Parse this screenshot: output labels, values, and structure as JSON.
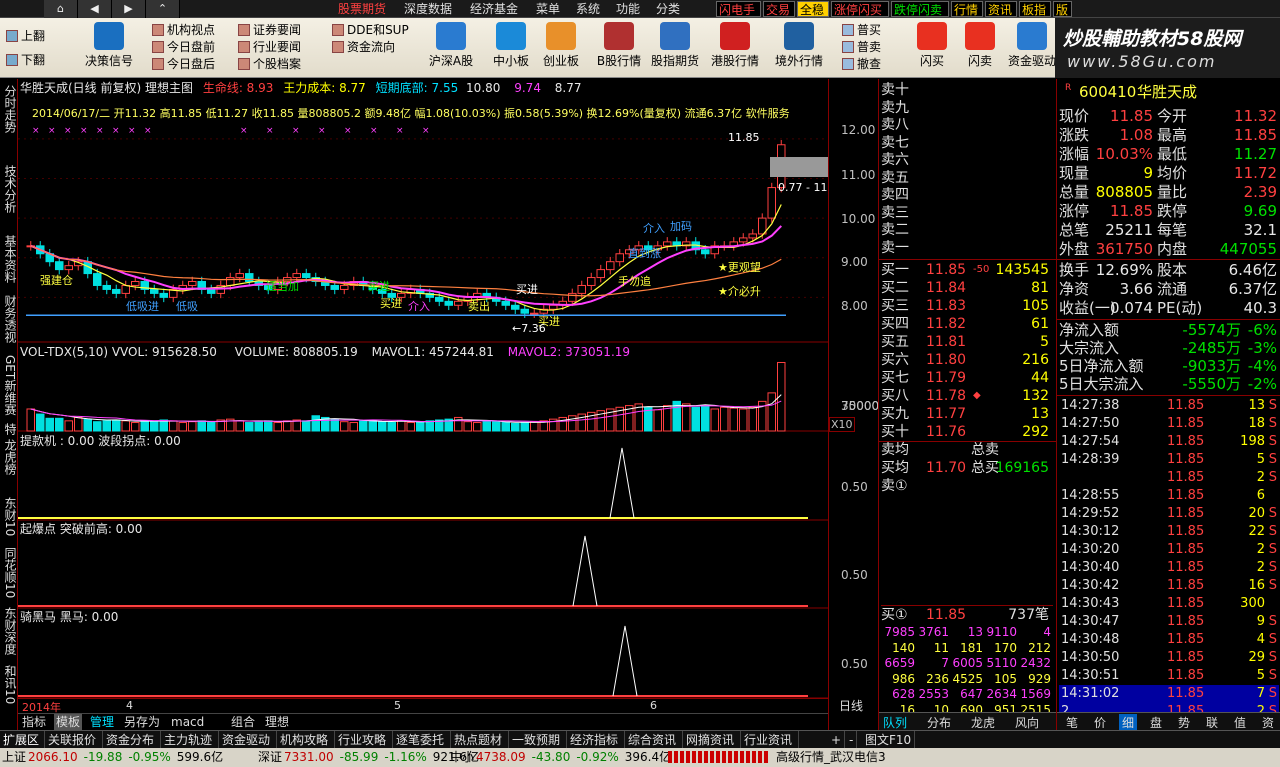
{
  "nav_buttons": [
    "⌂",
    "◀",
    "▶",
    "⌃"
  ],
  "menu": [
    "股票期货",
    "深度数据",
    "经济基金",
    "菜单",
    "系统",
    "功能",
    "分类"
  ],
  "top_tags": [
    {
      "label": "闪电手",
      "color": "#ff4040",
      "bg": "#000"
    },
    {
      "label": "交易",
      "color": "#ff4040",
      "bg": "#000"
    },
    {
      "label": "全稳",
      "color": "#000",
      "bg": "#ffd000"
    },
    {
      "label": "涨停闪买",
      "color": "#ff4040",
      "bg": "#000"
    },
    {
      "label": "跌停闪卖",
      "color": "#00e000",
      "bg": "#000"
    },
    {
      "label": "行情",
      "color": "#ffd000",
      "bg": "#000"
    },
    {
      "label": "资讯",
      "color": "#ffd000",
      "bg": "#000"
    },
    {
      "label": "板指",
      "color": "#ffd000",
      "bg": "#000"
    },
    {
      "label": "版",
      "color": "#ffd000",
      "bg": "#000"
    }
  ],
  "brand": {
    "title": "炒股輔助教材58股网",
    "url": "www.58Gu.com"
  },
  "toolbar": {
    "updown": [
      "上翻",
      "下翻"
    ],
    "decision": "决策信号",
    "small": [
      [
        "机构视点",
        "今日盘前",
        "今日盘后"
      ],
      [
        "证券要闻",
        "行业要闻",
        "个股档案"
      ],
      [
        "DDE和SUP",
        "资金流向"
      ]
    ],
    "big": [
      "沪深A股",
      "中小板",
      "创业板",
      "B股行情",
      "股指期货",
      "港股行情",
      "境外行情"
    ],
    "small2": [
      "普买",
      "普卖",
      "撤查"
    ],
    "big2": [
      "闪买",
      "闪卖",
      "资金驱动",
      "资金博弈",
      "DDE排名"
    ]
  },
  "left_tabs": [
    "分时走势",
    "技术分析",
    "基本资料",
    "财务透视",
    "GET新维赛",
    "特",
    "龙虎榜",
    "东财10",
    "同花顺10",
    "东财深度",
    "和讯10"
  ],
  "chart": {
    "header1": [
      "华胜天成(日线 前复权) 理想主图",
      "生命线: 8.93",
      "王力成本: 8.77",
      "短期底部: 7.55",
      "10.80",
      "9.74",
      "8.77"
    ],
    "header2": "2014/06/17/二  开11.32  高11.85  低11.27  收11.85  量808805.2  额9.48亿  幅1.08(10.03%)  振0.58(5.39%)  换12.69%(量复权)  流通6.37亿  软件服务",
    "annot": {
      "high": "11.85",
      "low": "7.36",
      "range": "0.77 - 11"
    },
    "labels": [
      "强建仓",
      "低吸进",
      "低吸",
      "适当加",
      "买进",
      "买进",
      "介入",
      "卖出",
      "买进",
      "买进",
      "手勿追",
      "直到涨",
      "介入",
      "加码",
      "★更观望",
      "★介必升"
    ],
    "vol_header": [
      "VOL-TDX(5,10)  VVOL: 915628.50",
      "VOLUME: 808805.19",
      "MAVOL1: 457244.81",
      "MAVOL2: 373051.19"
    ],
    "ind1": "提款机 : 0.00  波段拐点: 0.00",
    "ind2": "起爆点  突破前高: 0.00",
    "ind3": "骑黑马  黑马: 0.00",
    "year_axis": [
      "2014年",
      "4",
      "5",
      "6"
    ],
    "price_axis": [
      "12.00",
      "11.00",
      "10.00",
      "9.00",
      "8.00"
    ],
    "vol_axis": [
      "70000",
      "35000",
      "X10"
    ],
    "ind_axis": [
      "0.50",
      "0.50",
      "0.50"
    ],
    "period": "日线",
    "tabs": [
      "指标",
      "模板",
      "管理",
      "另存为",
      "macd",
      "组合",
      "理想"
    ]
  },
  "chart_data": {
    "type": "candlestick",
    "ylim": [
      7,
      12.5
    ],
    "close": [
      9.3,
      9.1,
      8.9,
      8.7,
      8.8,
      8.9,
      8.6,
      8.3,
      8.2,
      8.1,
      8.3,
      8.4,
      8.2,
      8.1,
      8.0,
      8.2,
      8.3,
      8.4,
      8.2,
      8.1,
      8.3,
      8.5,
      8.6,
      8.4,
      8.3,
      8.2,
      8.4,
      8.5,
      8.6,
      8.5,
      8.4,
      8.3,
      8.2,
      8.3,
      8.4,
      8.3,
      8.2,
      8.1,
      8.0,
      8.1,
      8.2,
      8.1,
      8.0,
      7.9,
      7.8,
      7.9,
      8.0,
      8.1,
      8.0,
      7.9,
      7.8,
      7.7,
      7.6,
      7.6,
      7.7,
      7.8,
      7.9,
      8.1,
      8.3,
      8.5,
      8.7,
      8.9,
      9.1,
      9.2,
      9.3,
      9.2,
      9.3,
      9.4,
      9.3,
      9.4,
      9.2,
      9.1,
      9.3,
      9.3,
      9.4,
      9.5,
      9.6,
      10.0,
      10.77,
      11.85
    ],
    "volume": [
      26000,
      20000,
      15000,
      15000,
      12000,
      16000,
      14000,
      11000,
      12000,
      13000,
      12000,
      10000,
      12000,
      11000,
      13000,
      12000,
      10000,
      11000,
      12000,
      10000,
      13000,
      14000,
      12000,
      10000,
      11000,
      12000,
      10000,
      12000,
      13000,
      12000,
      18000,
      16000,
      14000,
      11000,
      10000,
      12000,
      13000,
      11000,
      10000,
      12000,
      10000,
      11000,
      12000,
      13000,
      14000,
      16000,
      11000,
      10000,
      12000,
      11000,
      10000,
      9000,
      10000,
      11000,
      12000,
      14000,
      16000,
      18000,
      20000,
      22000,
      24000,
      26000,
      28000,
      30000,
      32000,
      28000,
      25000,
      30000,
      35000,
      32000,
      28000,
      30000,
      26000,
      28000,
      27000,
      26000,
      28000,
      35000,
      45000,
      80880
    ],
    "ind_spike_index": [
      3,
      2,
      2
    ]
  },
  "quote": {
    "sell": [
      [
        "卖十"
      ],
      [
        "卖九"
      ],
      [
        "卖八"
      ],
      [
        "卖七"
      ],
      [
        "卖六"
      ],
      [
        "卖五"
      ],
      [
        "卖四"
      ],
      [
        "卖三"
      ],
      [
        "卖二"
      ],
      [
        "卖一"
      ]
    ],
    "buy": [
      [
        "买一",
        "11.85",
        "143545",
        "-50"
      ],
      [
        "买二",
        "11.84",
        "81",
        ""
      ],
      [
        "买三",
        "11.83",
        "105",
        ""
      ],
      [
        "买四",
        "11.82",
        "61",
        ""
      ],
      [
        "买五",
        "11.81",
        "5",
        ""
      ],
      [
        "买六",
        "11.80",
        "216",
        ""
      ],
      [
        "买七",
        "11.79",
        "44",
        ""
      ],
      [
        "买八",
        "11.78",
        "132",
        "◆"
      ],
      [
        "买九",
        "11.77",
        "13",
        ""
      ],
      [
        "买十",
        "11.76",
        "292",
        ""
      ]
    ],
    "avg": [
      [
        "卖均",
        "",
        "总卖",
        ""
      ],
      [
        "买均",
        "11.70",
        "总买",
        "169165"
      ]
    ],
    "seat": "卖①",
    "buy1": [
      "买①",
      "11.85",
      "737笔"
    ],
    "grid": [
      [
        "7985",
        "3761",
        "13",
        "9110",
        "4"
      ],
      [
        "140",
        "11",
        "181",
        "170",
        "212"
      ],
      [
        "6659",
        "7",
        "6005",
        "5110",
        "2432"
      ],
      [
        "986",
        "236",
        "4525",
        "105",
        "929"
      ],
      [
        "628",
        "2553",
        "647",
        "2634",
        "1569"
      ],
      [
        "16",
        "10",
        "690",
        "951",
        "2515"
      ],
      [
        "293",
        "207",
        "5",
        "1",
        "50"
      ]
    ],
    "tabs": [
      "队列",
      "分布",
      "龙虎",
      "风向"
    ]
  },
  "stock": {
    "code": "600410",
    "name": "华胜天成",
    "flag": "R",
    "rows": [
      [
        "现价",
        "11.85",
        "今开",
        "11.32"
      ],
      [
        "涨跌",
        "1.08",
        "最高",
        "11.85"
      ],
      [
        "涨幅",
        "10.03%",
        "最低",
        "11.27"
      ],
      [
        "现量",
        "9",
        "均价",
        "11.72"
      ],
      [
        "总量",
        "808805",
        "量比",
        "2.39"
      ],
      [
        "涨停",
        "11.85",
        "跌停",
        "9.69"
      ],
      [
        "总笔",
        "25211",
        "每笔",
        "32.1"
      ],
      [
        "外盘",
        "361750",
        "内盘",
        "447055"
      ]
    ],
    "rows2": [
      [
        "换手",
        "12.69%",
        "股本",
        "6.46亿"
      ],
      [
        "净资",
        "3.66",
        "流通",
        "6.37亿"
      ],
      [
        "收益(一)",
        "0.074",
        "PE(动)",
        "40.3"
      ]
    ],
    "flows": [
      [
        "净流入额",
        "-5574万",
        "-6%"
      ],
      [
        "大宗流入",
        "-2485万",
        "-3%"
      ],
      [
        "5日净流入额",
        "-9033万",
        "-4%"
      ],
      [
        "5日大宗流入",
        "-5550万",
        "-2%"
      ]
    ],
    "ticks": [
      [
        "14:27:38",
        "11.85",
        "13",
        "S"
      ],
      [
        "14:27:50",
        "11.85",
        "18",
        "S"
      ],
      [
        "14:27:54",
        "11.85",
        "198",
        "S"
      ],
      [
        "14:28:39",
        "11.85",
        "5",
        "S"
      ],
      [
        "",
        "11.85",
        "2",
        "S"
      ],
      [
        "14:28:55",
        "11.85",
        "6",
        ""
      ],
      [
        "14:29:52",
        "11.85",
        "20",
        "S"
      ],
      [
        "14:30:12",
        "11.85",
        "22",
        "S"
      ],
      [
        "14:30:20",
        "11.85",
        "2",
        "S"
      ],
      [
        "14:30:40",
        "11.85",
        "2",
        "S"
      ],
      [
        "14:30:42",
        "11.85",
        "16",
        "S"
      ],
      [
        "14:30:43",
        "11.85",
        "300",
        ""
      ],
      [
        "14:30:47",
        "11.85",
        "9",
        "S"
      ],
      [
        "14:30:48",
        "11.85",
        "4",
        "S"
      ],
      [
        "14:30:50",
        "11.85",
        "29",
        "S"
      ],
      [
        "14:30:51",
        "11.85",
        "5",
        "S"
      ],
      [
        "14:31:02",
        "11.85",
        "7",
        "S"
      ],
      [
        "2",
        "11.85",
        "2",
        "S"
      ]
    ],
    "tabs": [
      "笔",
      "价",
      "细",
      "盘",
      "势",
      "联",
      "值",
      "资"
    ]
  },
  "bottom_tabs": [
    "扩展区",
    "关联报价",
    "资金分布",
    "主力轨迹",
    "资金驱动",
    "机构攻略",
    "行业攻略",
    "逐笔委托",
    "热点题材",
    "一致预期",
    "经济指标",
    "综合资讯",
    "网摘资讯",
    "行业资讯"
  ],
  "bottom_right": [
    "+",
    "-",
    "图文F10"
  ],
  "status": {
    "sh": [
      "上证",
      "2066.10",
      "-19.88",
      "-0.95%",
      "599.6亿"
    ],
    "sz": [
      "深证",
      "7331.00",
      "-85.99",
      "-1.16%",
      "921.6亿"
    ],
    "zx": [
      "中小",
      "4738.09",
      "-43.80",
      "-0.92%",
      "396.4亿"
    ],
    "server": "高级行情_武汉电信3"
  }
}
